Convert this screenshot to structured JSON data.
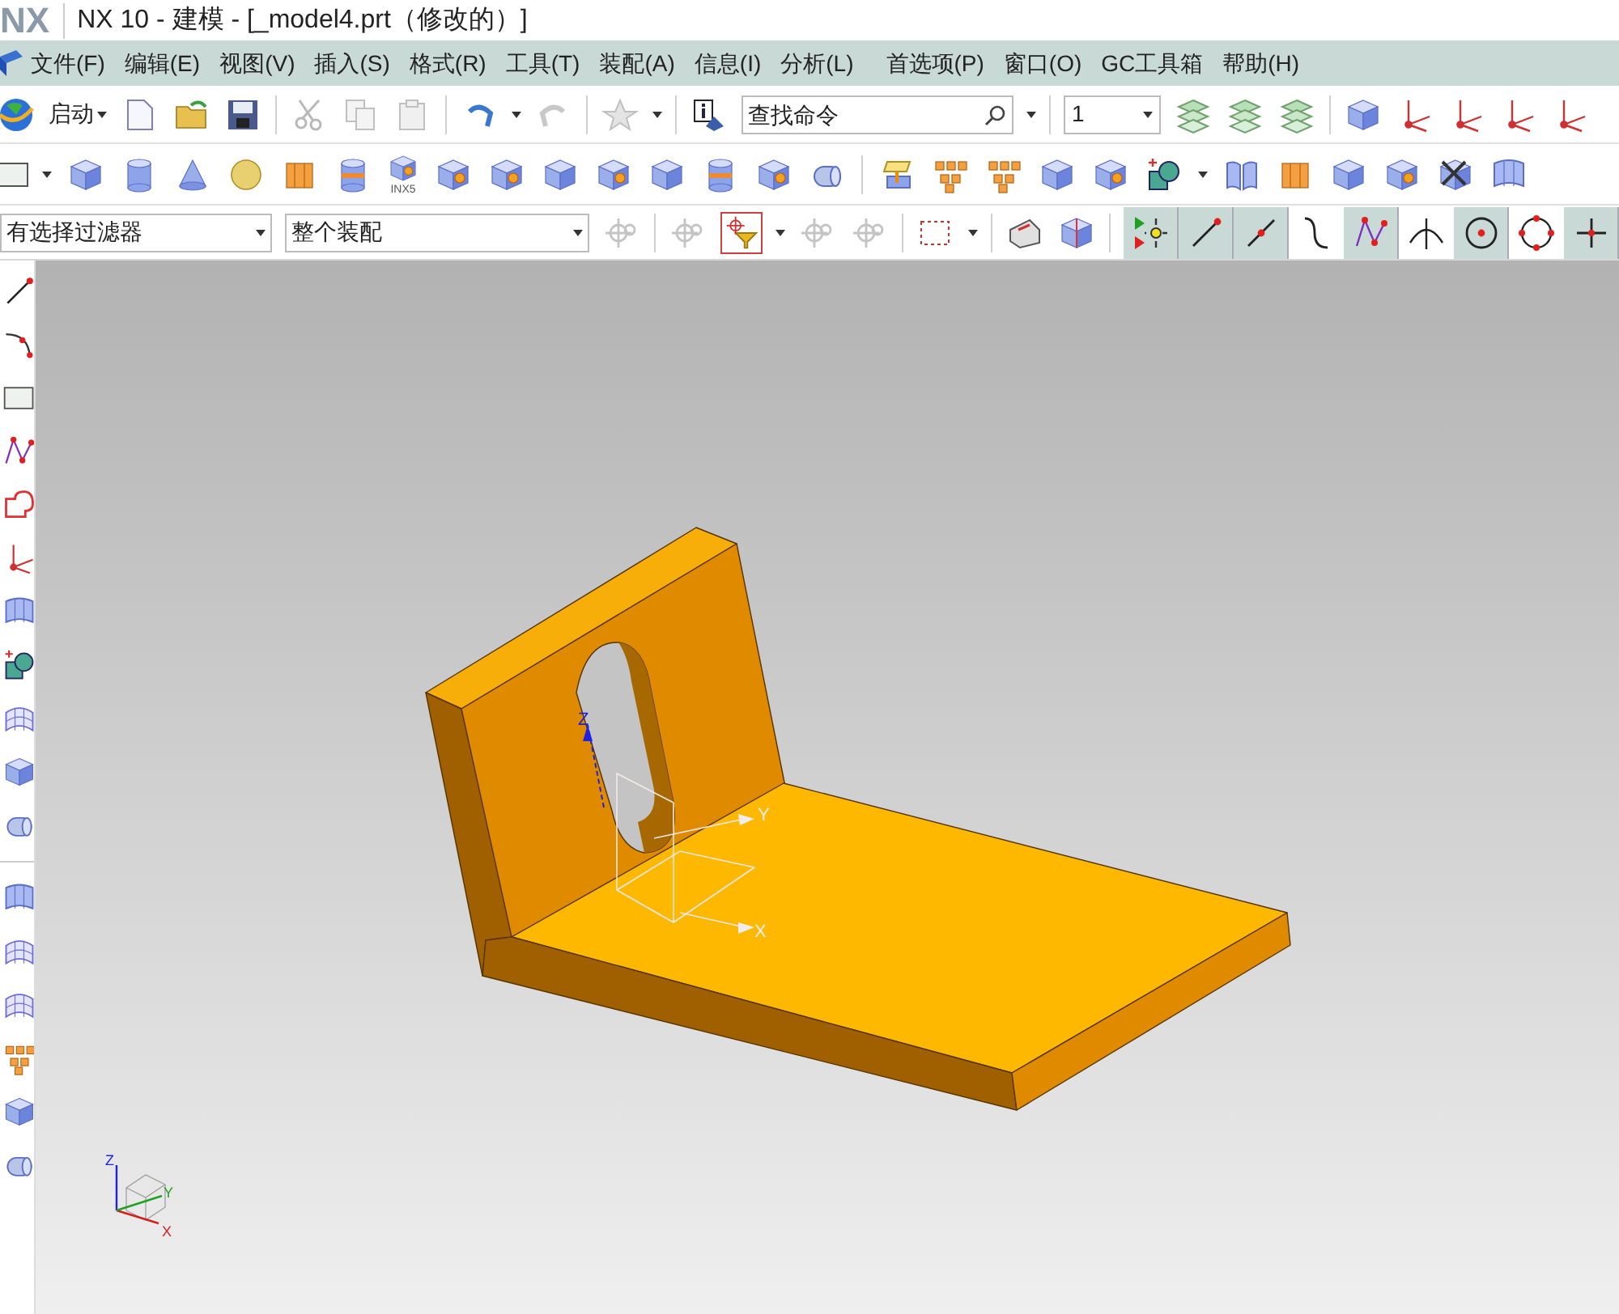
{
  "window": {
    "logo": "NX",
    "title": "NX 10 - 建模 - [_model4.prt（修改的）]"
  },
  "menu_bar": [
    "文件(F)",
    "编辑(E)",
    "视图(V)",
    "插入(S)",
    "格式(R)",
    "工具(T)",
    "装配(A)",
    "信息(I)",
    "分析(L)",
    "首选项(P)",
    "窗口(O)",
    "GC工具箱",
    "帮助(H)"
  ],
  "standard_toolbar": {
    "start_label": "启动",
    "search": {
      "placeholder": "查找命令"
    },
    "layer": {
      "value": "1"
    }
  },
  "feature_toolbar": {
    "legacy_badge": "INX5"
  },
  "selection_bar": {
    "filter": {
      "value": "有选择过滤器"
    },
    "scope": {
      "value": "整个装配"
    },
    "snap_buttons": [
      {
        "selected": true
      },
      {
        "selected": true
      },
      {
        "selected": true
      },
      {
        "selected": false
      },
      {
        "selected": true
      },
      {
        "selected": false
      },
      {
        "selected": true
      },
      {
        "selected": false
      },
      {
        "selected": true
      }
    ]
  },
  "viewport": {
    "wcs_labels": [
      "Z",
      "Y",
      "X"
    ],
    "triad_labels": [
      "Z",
      "Y",
      "X"
    ]
  }
}
